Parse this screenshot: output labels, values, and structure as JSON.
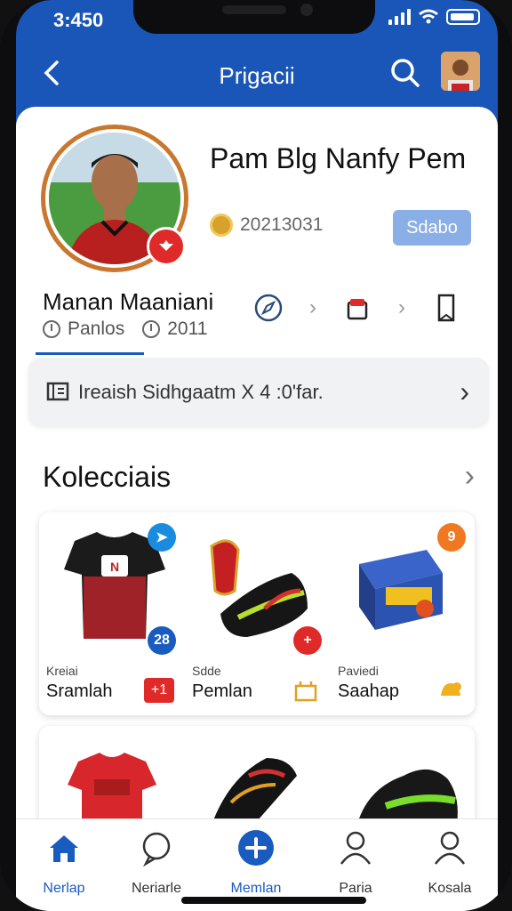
{
  "status_bar": {
    "time": "3:450"
  },
  "header": {
    "title": "Prigacii",
    "back_icon": "chevron-left-icon",
    "search_icon": "search-icon"
  },
  "profile": {
    "name": "Pam Blg Nanfy Pem",
    "coins": "20213031",
    "edit_label": "Sdabo",
    "sub_name": "Manan Maaniani",
    "meta_1": "Panlos",
    "meta_2": "2011"
  },
  "banner": {
    "text": "Ireaish Sidhgaatm X 4 :0'far."
  },
  "collections": {
    "title": "Kolecciais",
    "items": [
      {
        "kicker": "Kreiai",
        "label": "Sramlah",
        "tag": "+1",
        "tag_color": "#e02a2a",
        "pin": "28",
        "pin_color": "#1a5bbf"
      },
      {
        "kicker": "Sdde",
        "label": "Pemlan",
        "tag": "",
        "tag_color": "#f0a020",
        "pin": "+",
        "pin_color": "#e02a2a"
      },
      {
        "kicker": "Paviedi",
        "label": "Saahap",
        "tag": "",
        "tag_color": "#f0a020",
        "pin": "9",
        "pin_color": "#f07820"
      }
    ]
  },
  "nav": {
    "items": [
      {
        "label": "Nerlap",
        "icon": "home-icon"
      },
      {
        "label": "Neriarle",
        "icon": "chat-icon"
      },
      {
        "label": "Memlan",
        "icon": "plus-icon"
      },
      {
        "label": "Paria",
        "icon": "user-icon"
      },
      {
        "label": "Kosala",
        "icon": "profile-icon"
      }
    ]
  }
}
